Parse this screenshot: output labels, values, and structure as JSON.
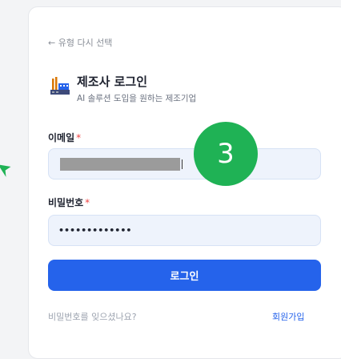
{
  "back_link": "← 유형 다시 선택",
  "header": {
    "title": "제조사 로그인",
    "subtitle": "AI 솔루션 도입을 원하는 제조기업",
    "icon": "factory-icon"
  },
  "email": {
    "label": "이메일",
    "required_mark": "*",
    "value": "[redacted]"
  },
  "password": {
    "label": "비밀번호",
    "required_mark": "*",
    "value": "•••••••••••••"
  },
  "login_button": "로그인",
  "forgot_password": "비밀번호를 잊으셨나요?",
  "signup": "회원가입",
  "step_badge": "3",
  "colors": {
    "primary": "#2563eb",
    "badge": "#1fb255",
    "required": "#ef4444",
    "arrow": "#1fb255"
  }
}
